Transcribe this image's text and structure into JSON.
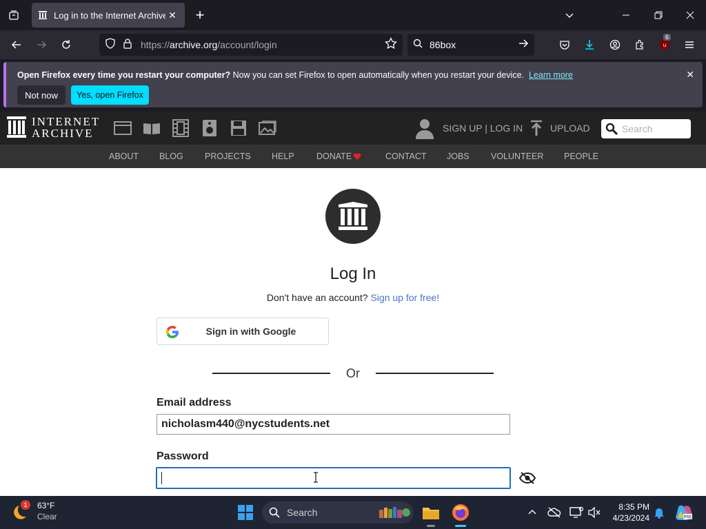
{
  "browser": {
    "tab": {
      "title": "Log in to the Internet Archive"
    },
    "url": {
      "prefix": "https://",
      "host": "archive.org",
      "path": "/account/login"
    },
    "search": {
      "query": "86box"
    },
    "extension_badge": "6"
  },
  "notification": {
    "bold_text": "Open Firefox every time you restart your computer?",
    "text": " Now you can set Firefox to open automatically when you restart your device.",
    "link": "Learn more",
    "not_now_label": "Not now",
    "yes_label": "Yes, open Firefox"
  },
  "archive_header": {
    "logo_line1": "INTERNET",
    "logo_line2": "ARCHIVE",
    "signup_login": "SIGN UP | LOG IN",
    "upload": "UPLOAD",
    "search_placeholder": "Search",
    "subnav": [
      "ABOUT",
      "BLOG",
      "PROJECTS",
      "HELP",
      "DONATE",
      "CONTACT",
      "JOBS",
      "VOLUNTEER",
      "PEOPLE"
    ]
  },
  "login": {
    "heading": "Log In",
    "no_account": "Don't have an account?",
    "signup_link": "Sign up for free!",
    "google_label": "Sign in with Google",
    "or": "Or",
    "email_label": "Email address",
    "email_value": "nicholasm440@nycstudents.net",
    "password_label": "Password",
    "password_value": ""
  },
  "taskbar": {
    "weather_temp": "63°F",
    "weather_desc": "Clear",
    "weather_badge": "1",
    "search_placeholder": "Search",
    "time": "8:35 PM",
    "date": "4/23/2024"
  },
  "colors": {
    "accent_button": "#00ddff",
    "link": "#4a74c0",
    "focus_border": "#1d6fb8",
    "donate_heart": "#e0202a"
  }
}
